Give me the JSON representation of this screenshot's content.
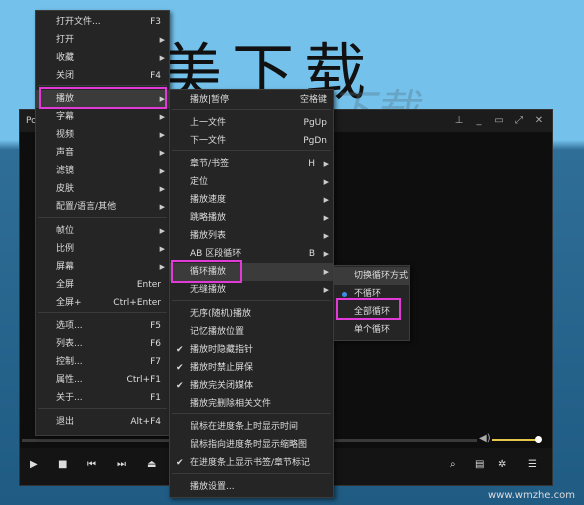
{
  "banner": {
    "text": "美下载",
    "ghost": "下载"
  },
  "player": {
    "title": "Po",
    "window_buttons": [
      "pin-icon",
      "minimize-icon",
      "restore-icon",
      "fullscreen-icon",
      "close-icon"
    ]
  },
  "menu1": {
    "items": [
      {
        "label": "打开文件...",
        "shortcut": "F3"
      },
      {
        "label": "打开",
        "arrow": true
      },
      {
        "label": "收藏",
        "arrow": true
      },
      {
        "label": "关闭",
        "shortcut": "F4"
      },
      {
        "label": "播放",
        "arrow": true,
        "active": true
      },
      {
        "label": "字幕",
        "arrow": true
      },
      {
        "label": "视频",
        "arrow": true
      },
      {
        "label": "声音",
        "arrow": true
      },
      {
        "label": "滤镜",
        "arrow": true
      },
      {
        "label": "皮肤",
        "arrow": true
      },
      {
        "label": "配置/语言/其他",
        "arrow": true
      },
      {
        "label": "帧位",
        "arrow": true
      },
      {
        "label": "比例",
        "arrow": true
      },
      {
        "label": "屏幕",
        "arrow": true
      },
      {
        "label": "全屏",
        "shortcut": "Enter"
      },
      {
        "label": "全屏+",
        "shortcut": "Ctrl+Enter"
      },
      {
        "label": "选项...",
        "shortcut": "F5"
      },
      {
        "label": "列表...",
        "shortcut": "F6"
      },
      {
        "label": "控制...",
        "shortcut": "F7"
      },
      {
        "label": "属性...",
        "shortcut": "Ctrl+F1"
      },
      {
        "label": "关于...",
        "shortcut": "F1"
      },
      {
        "label": "退出",
        "shortcut": "Alt+F4"
      }
    ]
  },
  "menu2": {
    "items": [
      {
        "label": "播放|暂停",
        "shortcut": "空格键"
      },
      {
        "label": "上一文件",
        "shortcut": "PgUp"
      },
      {
        "label": "下一文件",
        "shortcut": "PgDn"
      },
      {
        "label": "章节/书签",
        "shortcut": "H",
        "arrow": true
      },
      {
        "label": "定位",
        "arrow": true
      },
      {
        "label": "播放速度",
        "arrow": true
      },
      {
        "label": "跳略播放",
        "arrow": true
      },
      {
        "label": "播放列表",
        "arrow": true
      },
      {
        "label": "AB 区段循环",
        "shortcut": "B",
        "arrow": true
      },
      {
        "label": "循环播放",
        "arrow": true,
        "active": true
      },
      {
        "label": "无缝播放",
        "arrow": true
      },
      {
        "label": "无序(随机)播放"
      },
      {
        "label": "记忆播放位置"
      },
      {
        "label": "播放时隐藏指针",
        "checked": true
      },
      {
        "label": "播放时禁止屏保",
        "checked": true
      },
      {
        "label": "播放完关闭媒体",
        "checked": true
      },
      {
        "label": "播放完删除相关文件"
      },
      {
        "label": "鼠标在进度条上时显示时间"
      },
      {
        "label": "鼠标指向进度条时显示缩略图"
      },
      {
        "label": "在进度条上显示书签/章节标记",
        "checked": true
      },
      {
        "label": "播放设置..."
      }
    ]
  },
  "menu3": {
    "items": [
      {
        "label": "切换循环方式",
        "header": true
      },
      {
        "label": "不循环",
        "radio": true
      },
      {
        "label": "全部循环"
      },
      {
        "label": "单个循环"
      }
    ]
  },
  "controls": [
    "play-icon",
    "stop-icon",
    "prev-icon",
    "next-icon",
    "eject-icon",
    "search-video-icon",
    "subtitle-icon",
    "settings-icon",
    "playlist-icon"
  ],
  "volume": {
    "level": 0.9
  },
  "watermark": "www.wmzhe.com"
}
